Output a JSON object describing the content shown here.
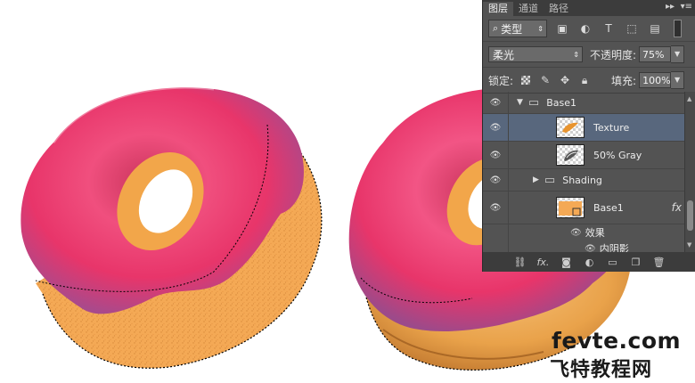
{
  "panel": {
    "tabs": [
      {
        "label": "图层",
        "active": true
      },
      {
        "label": "通道",
        "active": false
      },
      {
        "label": "路径",
        "active": false
      }
    ],
    "filter": {
      "label": "类型"
    },
    "blend_mode": "柔光",
    "opacity_label": "不透明度:",
    "opacity_value": "75%",
    "lock_label": "锁定:",
    "fill_label": "填充:",
    "fill_value": "100%",
    "layers": [
      {
        "name": "Base1",
        "kind": "group",
        "expanded": true,
        "visible": true
      },
      {
        "name": "Texture",
        "kind": "layer",
        "selected": true,
        "visible": true
      },
      {
        "name": "50% Gray",
        "kind": "layer",
        "visible": true
      },
      {
        "name": "Shading",
        "kind": "group",
        "expanded": false,
        "visible": true
      },
      {
        "name": "Base1",
        "kind": "layer",
        "has_fx": true,
        "visible": true
      }
    ],
    "effects_label": "效果",
    "effect_items": [
      "内阴影"
    ],
    "fx_badge": "fx",
    "accent": "#58677d"
  },
  "watermark": {
    "line1": "fevte.com",
    "line2": "飞特教程网"
  },
  "colors": {
    "frosting": "#e83a6c",
    "dough": "#f4a955",
    "panel_bg": "#535353"
  }
}
